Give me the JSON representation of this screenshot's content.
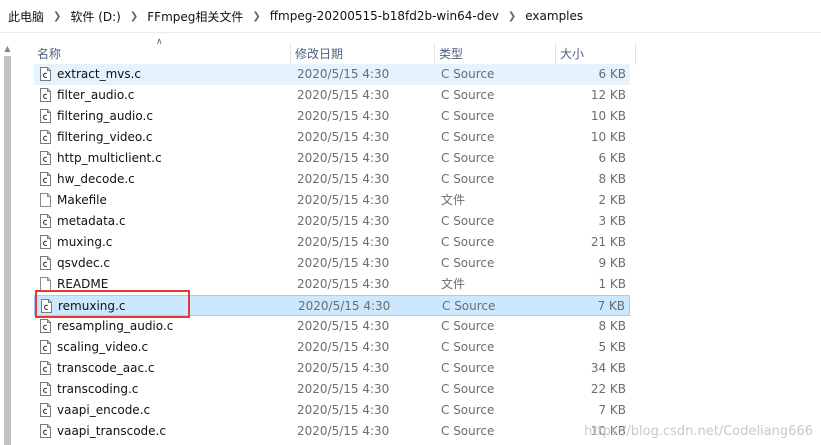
{
  "breadcrumb": [
    "此电脑",
    "软件 (D:)",
    "FFmpeg相关文件",
    "ffmpeg-20200515-b18fd2b-win64-dev",
    "examples"
  ],
  "columns": {
    "name": "名称",
    "date": "修改日期",
    "type": "类型",
    "size": "大小"
  },
  "files": [
    {
      "name": "extract_mvs.c",
      "date": "2020/5/15 4:30",
      "type": "C Source",
      "size": "6 KB",
      "icon": "c-source-file-icon",
      "state": "hover"
    },
    {
      "name": "filter_audio.c",
      "date": "2020/5/15 4:30",
      "type": "C Source",
      "size": "12 KB",
      "icon": "c-source-file-icon"
    },
    {
      "name": "filtering_audio.c",
      "date": "2020/5/15 4:30",
      "type": "C Source",
      "size": "10 KB",
      "icon": "c-source-file-icon"
    },
    {
      "name": "filtering_video.c",
      "date": "2020/5/15 4:30",
      "type": "C Source",
      "size": "10 KB",
      "icon": "c-source-file-icon"
    },
    {
      "name": "http_multiclient.c",
      "date": "2020/5/15 4:30",
      "type": "C Source",
      "size": "6 KB",
      "icon": "c-source-file-icon"
    },
    {
      "name": "hw_decode.c",
      "date": "2020/5/15 4:30",
      "type": "C Source",
      "size": "8 KB",
      "icon": "c-source-file-icon"
    },
    {
      "name": "Makefile",
      "date": "2020/5/15 4:30",
      "type": "文件",
      "size": "2 KB",
      "icon": "blank-file-icon"
    },
    {
      "name": "metadata.c",
      "date": "2020/5/15 4:30",
      "type": "C Source",
      "size": "3 KB",
      "icon": "c-source-file-icon"
    },
    {
      "name": "muxing.c",
      "date": "2020/5/15 4:30",
      "type": "C Source",
      "size": "21 KB",
      "icon": "c-source-file-icon"
    },
    {
      "name": "qsvdec.c",
      "date": "2020/5/15 4:30",
      "type": "C Source",
      "size": "9 KB",
      "icon": "c-source-file-icon"
    },
    {
      "name": "README",
      "date": "2020/5/15 4:30",
      "type": "文件",
      "size": "1 KB",
      "icon": "blank-file-icon"
    },
    {
      "name": "remuxing.c",
      "date": "2020/5/15 4:30",
      "type": "C Source",
      "size": "7 KB",
      "icon": "c-source-file-icon",
      "state": "selected"
    },
    {
      "name": "resampling_audio.c",
      "date": "2020/5/15 4:30",
      "type": "C Source",
      "size": "8 KB",
      "icon": "c-source-file-icon"
    },
    {
      "name": "scaling_video.c",
      "date": "2020/5/15 4:30",
      "type": "C Source",
      "size": "5 KB",
      "icon": "c-source-file-icon"
    },
    {
      "name": "transcode_aac.c",
      "date": "2020/5/15 4:30",
      "type": "C Source",
      "size": "34 KB",
      "icon": "c-source-file-icon"
    },
    {
      "name": "transcoding.c",
      "date": "2020/5/15 4:30",
      "type": "C Source",
      "size": "22 KB",
      "icon": "c-source-file-icon"
    },
    {
      "name": "vaapi_encode.c",
      "date": "2020/5/15 4:30",
      "type": "C Source",
      "size": "7 KB",
      "icon": "c-source-file-icon"
    },
    {
      "name": "vaapi_transcode.c",
      "date": "2020/5/15 4:30",
      "type": "C Source",
      "size": "10 KB",
      "icon": "c-source-file-icon"
    }
  ],
  "annotation": {
    "highlight_color": "#e53935",
    "highlighted_item": "remuxing.c"
  },
  "watermark": "https://blog.csdn.net/Codeliang666",
  "colors": {
    "selected_bg": "#cce8ff",
    "selected_border": "#99d1ff",
    "hover_bg": "#e5f3ff",
    "header_text": "#4d6082"
  }
}
